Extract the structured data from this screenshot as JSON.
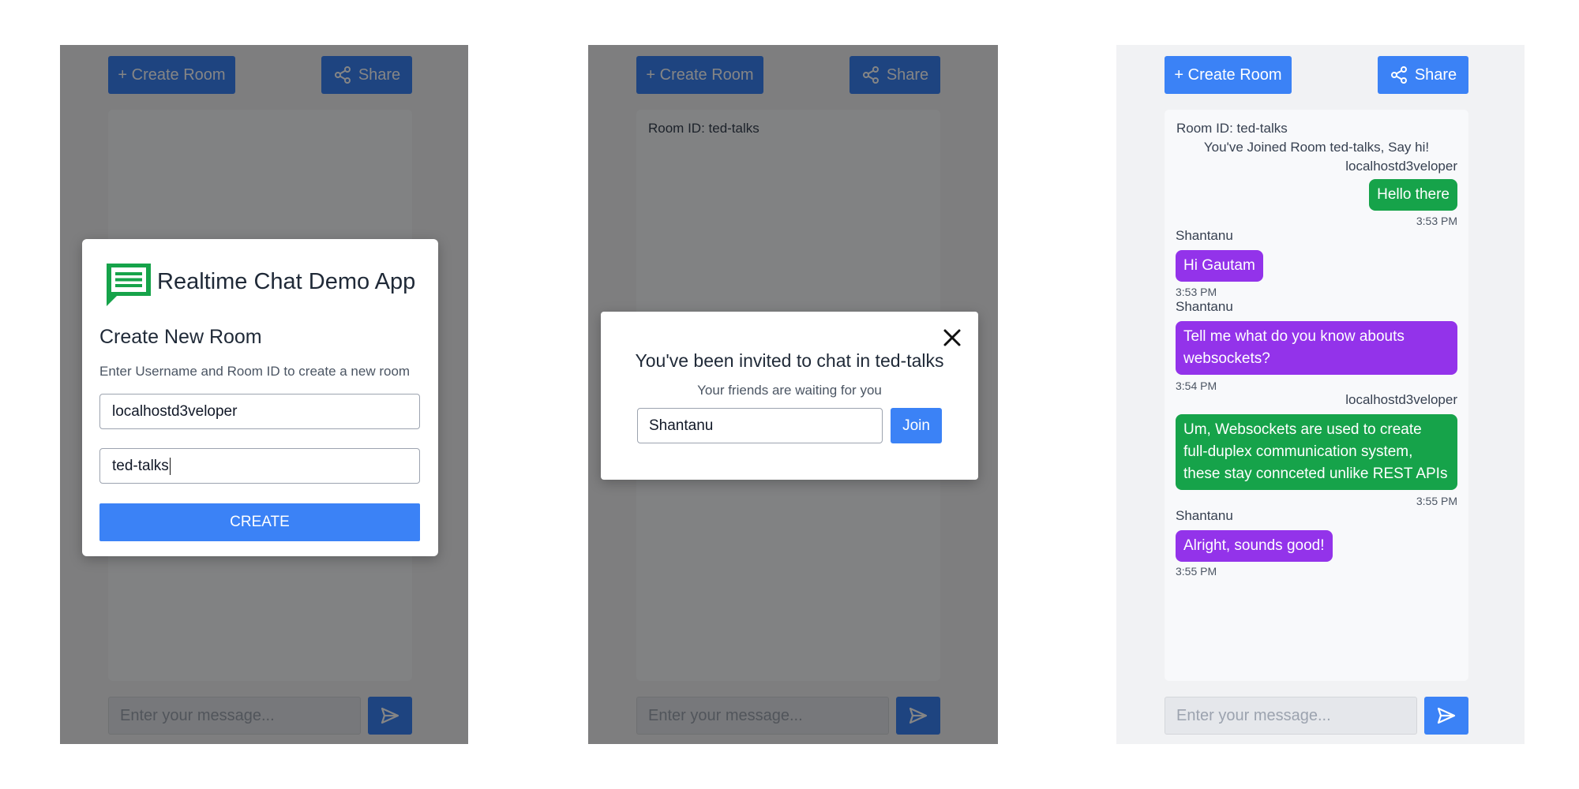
{
  "header": {
    "create_room_label": "+ Create Room",
    "share_label": "Share"
  },
  "composer": {
    "placeholder": "Enter your message..."
  },
  "create_modal": {
    "app_title": "Realtime Chat Demo App",
    "heading": "Create New Room",
    "description": "Enter Username and Room ID to create a new room",
    "username_value": "localhostd3veloper",
    "room_id_value": "ted-talks",
    "create_label": "CREATE"
  },
  "invite_modal": {
    "room_label": "Room ID: ted-talks",
    "title": "You've been invited to chat in ted-talks",
    "subtitle": "Your friends are waiting for you",
    "name_value": "Shantanu",
    "join_label": "Join"
  },
  "chat": {
    "room_label": "Room ID: ted-talks",
    "system_message": "You've Joined Room ted-talks, Say hi!",
    "messages": [
      {
        "sender": "localhostd3veloper",
        "text": "Hello there",
        "time": "3:53 PM",
        "side": "right"
      },
      {
        "sender": "Shantanu",
        "text": "Hi Gautam",
        "time": "3:53 PM",
        "side": "left"
      },
      {
        "sender": "Shantanu",
        "text": "Tell me what do you know abouts websockets?",
        "time": "3:54 PM",
        "side": "left"
      },
      {
        "sender": "localhostd3veloper",
        "text": "Um, Websockets are used to create full-duplex communication system, these stay connceted unlike REST APIs",
        "time": "3:55 PM",
        "side": "right"
      },
      {
        "sender": "Shantanu",
        "text": "Alright, sounds good!",
        "time": "3:55 PM",
        "side": "left"
      }
    ]
  },
  "colors": {
    "primary": "#3b82f6",
    "outgoing": "#16a34a",
    "incoming": "#9333ea",
    "logo": "#16a34a"
  }
}
